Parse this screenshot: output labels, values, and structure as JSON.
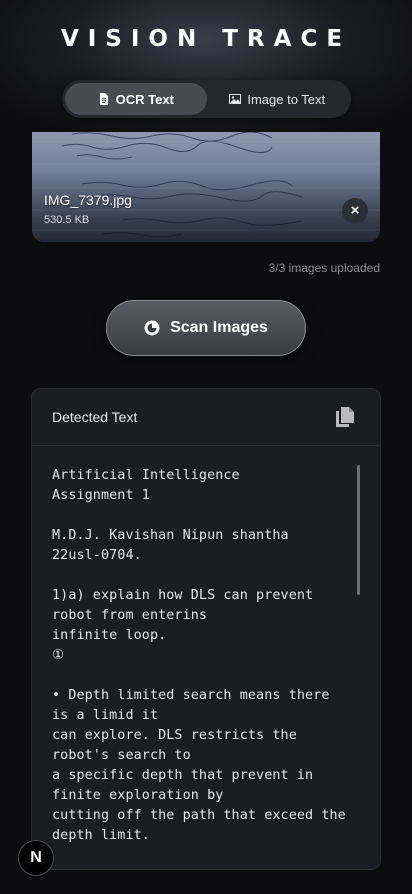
{
  "app": {
    "title": "VISION TRACE"
  },
  "tabs": [
    {
      "label": "OCR Text",
      "icon": "document-icon",
      "active": true
    },
    {
      "label": "Image to Text",
      "icon": "image-icon",
      "active": false
    }
  ],
  "upload": {
    "file_name": "IMG_7379.jpg",
    "file_size": "530.5 KB",
    "count_text": "3/3 images uploaded"
  },
  "scan": {
    "label": "Scan Images",
    "icon": "scan-icon"
  },
  "result": {
    "title": "Detected Text",
    "copy_icon": "copy-icon",
    "text": "Artificial Intelligence\nAssignment 1\n\nM.D.J. Kavishan Nipun shantha\n22usl-0704.\n\n1)a) explain how DLS can prevent\nrobot from enterins\ninfinite loop.\n①\n\n• Depth limited search means there\nis a limid it\ncan explore. DLS restricts the\nrobot's search to\na specific depth that prevent in\nfinite exploration by\ncutting off the path that exceed the\ndepth limit."
  },
  "badge": {
    "label": "N"
  }
}
